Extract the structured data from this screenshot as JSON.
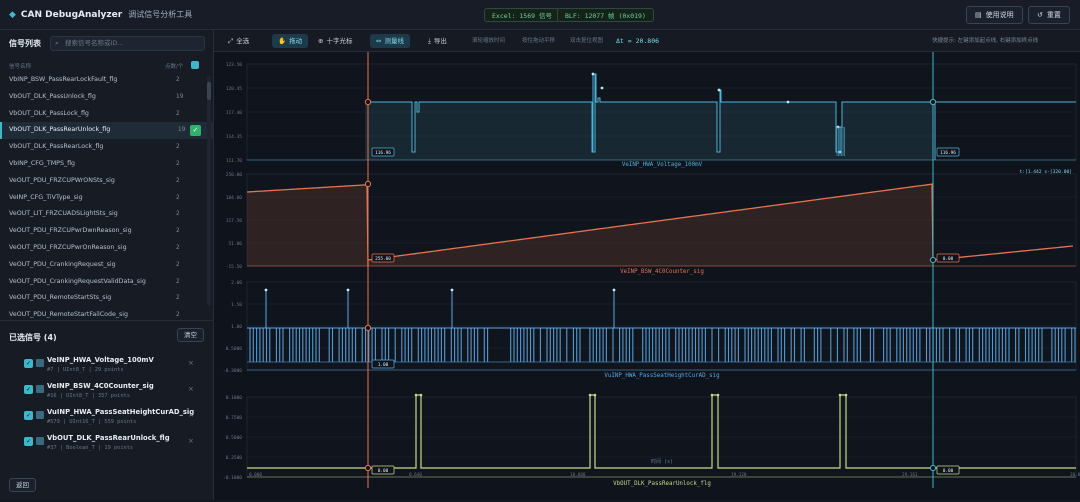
{
  "topbar": {
    "logo": "CAN DebugAnalyzer",
    "subtitle": "调试信号分析工具",
    "stat_excel": "Excel: 1569 信号",
    "stat_blf": "BLF: 12077 帧 (0x019)",
    "help_label": "使用说明",
    "reset_label": "重置"
  },
  "sidebar": {
    "title": "信号列表",
    "search_placeholder": "搜索信号名称或ID...",
    "col_name": "信号名称",
    "col_count": "点数/个",
    "signals": [
      {
        "name": "VbINP_BSW_PassRearLockFault_flg",
        "count": "2"
      },
      {
        "name": "VbOUT_DLK_PassUnlock_flg",
        "count": "19"
      },
      {
        "name": "VbOUT_DLK_PassLock_flg",
        "count": "2"
      },
      {
        "name": "VbOUT_DLK_PassRearUnlock_flg",
        "count": "19",
        "active": true
      },
      {
        "name": "VbOUT_DLK_PassRearLock_flg",
        "count": "2"
      },
      {
        "name": "VbINP_CFG_TMPS_flg",
        "count": "2"
      },
      {
        "name": "VeOUT_PDU_FRZCUPWrONSts_sig",
        "count": "2"
      },
      {
        "name": "VeINP_CFG_TiVType_sig",
        "count": "2"
      },
      {
        "name": "VeOUT_LIT_FRZCUADSLightSts_sig",
        "count": "2"
      },
      {
        "name": "VeOUT_PDU_FRZCUPwrDwnReason_sig",
        "count": "2"
      },
      {
        "name": "VeOUT_PDU_FRZCUPwrOnReason_sig",
        "count": "2"
      },
      {
        "name": "VeOUT_PDU_CrankingRequest_sig",
        "count": "2"
      },
      {
        "name": "VeOUT_PDU_CrankingRequestValidData_sig",
        "count": "2"
      },
      {
        "name": "VeOUT_PDU_RemoteStartSts_sig",
        "count": "2"
      },
      {
        "name": "VeOUT_PDU_RemoteStartFailCode_sig",
        "count": "2"
      }
    ]
  },
  "selected": {
    "title": "已选信号 (4)",
    "clear_label": "清空",
    "back_label": "返回",
    "items": [
      {
        "name": "VeINP_HWA_Voltage_100mV",
        "meta": "#7 | UInt8_T | 29 points",
        "color": "#4fb3d9"
      },
      {
        "name": "VeINP_BSW_4C0Counter_sig",
        "meta": "#16 | UInt8_T | 357 points",
        "color": "#e8734f"
      },
      {
        "name": "VuINP_HWA_PassSeatHeightCurAD_sig",
        "meta": "#579 | UInt16_T | 559 points",
        "color": "#4fb3d9"
      },
      {
        "name": "VbOUT_DLK_PassRearUnlock_flg",
        "meta": "#37 | Boolean_T | 19 points",
        "color": "#c9d98a"
      }
    ]
  },
  "toolbar": {
    "fit_label": "全选",
    "drag_label": "拖动",
    "crosshair_label": "十字光标",
    "measure_label": "测量线",
    "export_label": "导出",
    "hint1": "滚轮缩放时间",
    "hint2": "按住拖动平移",
    "hint3": "双击复位视图",
    "delta": "Δt = 20.806",
    "right_hint": "快捷提示: 左键添加起点线, 右键添加终点线"
  },
  "plots": {
    "p1": {
      "name": "VeINP_HWA_Voltage_100mV",
      "y_ticks": [
        "123.50",
        "120.45",
        "117.40",
        "114.35",
        "111.70"
      ],
      "cursor_a_value": "116.96",
      "cursor_b_value": "116.96",
      "coord_readout": "t:[1.442 s-[320.00]"
    },
    "p2": {
      "name": "VeINP_BSW_4C0Counter_sig",
      "y_ticks": [
        "250.00",
        "184.00",
        "117.50",
        "51.00",
        "-15.50"
      ],
      "cursor_a_value": "255.00",
      "cursor_b_value": "0.00"
    },
    "p3": {
      "name": "VuINP_HWA_PassSeatHeightCurAD_sig",
      "y_ticks": [
        "2.00",
        "1.50",
        "1.00",
        "0.5000",
        "-0.3000"
      ],
      "cursor_a_value": "1.00"
    },
    "p4": {
      "name": "VbOUT_DLK_PassRearUnlock_flg",
      "y_ticks": [
        "0.1000",
        "0.7500",
        "0.5000",
        "0.2500",
        "-0.1000"
      ],
      "cursor_a_value": "0.00",
      "cursor_b_value": "0.00",
      "x_ticks": [
        "0.000",
        "0.640",
        "10.000",
        "19.120",
        "29.161",
        "30.000"
      ],
      "x_axis_label": "时间 (s)"
    }
  },
  "colors": {
    "voltage": "#4fb3d9",
    "counter": "#e8734f",
    "seat": "#5aa8e6",
    "unlock": "#c9d98a",
    "cursor_a": "#e8734f",
    "cursor_b": "#3fb6c9"
  },
  "icons": {
    "fit": "expand-icon",
    "drag": "hand-icon",
    "crosshair": "crosshair-icon",
    "measure": "measure-icon",
    "export": "download-icon"
  }
}
